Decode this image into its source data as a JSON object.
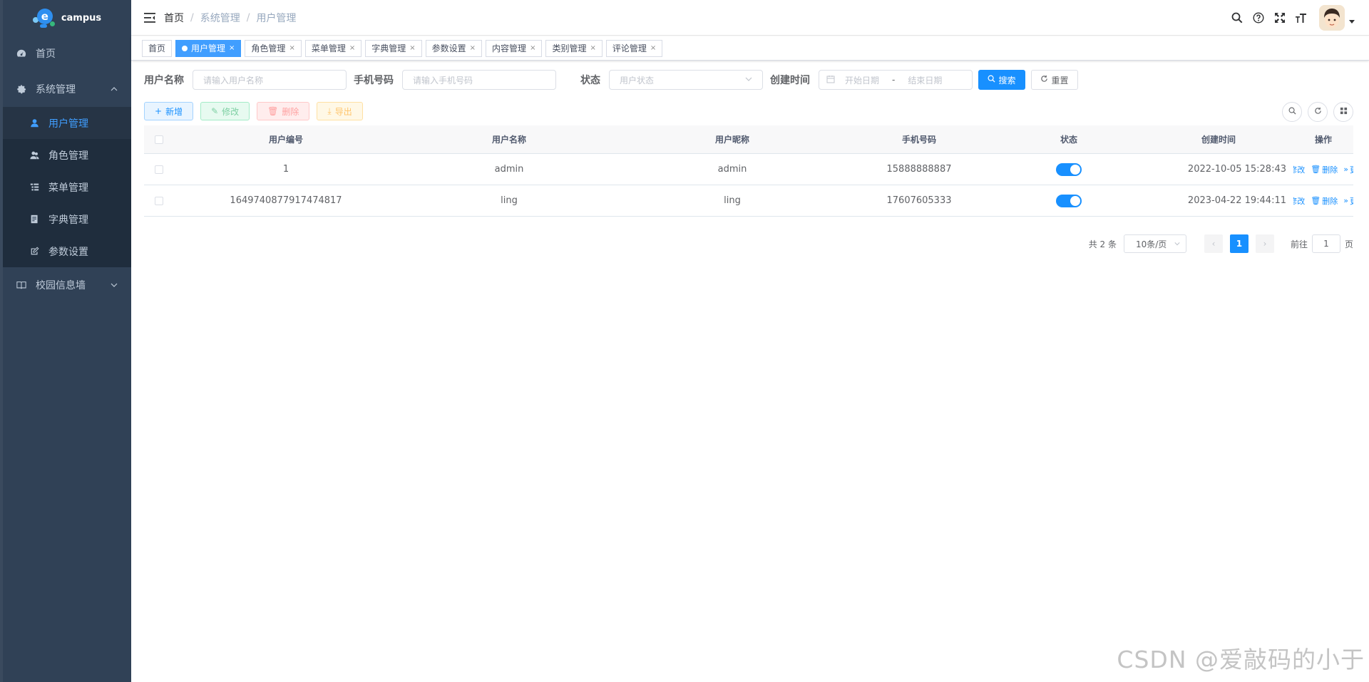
{
  "sidebar": {
    "logo_text": "campus",
    "logo_letter": "e",
    "items": [
      {
        "label": "首页",
        "icon": "dashboard-icon"
      },
      {
        "label": "系统管理",
        "icon": "gear-icon",
        "expanded": true
      },
      {
        "label": "校园信息墙",
        "icon": "book-icon",
        "expanded": false
      }
    ],
    "submenu": [
      {
        "label": "用户管理",
        "icon": "user-icon",
        "active": true
      },
      {
        "label": "角色管理",
        "icon": "peoples-icon"
      },
      {
        "label": "菜单管理",
        "icon": "tree-table-icon"
      },
      {
        "label": "字典管理",
        "icon": "dict-icon"
      },
      {
        "label": "参数设置",
        "icon": "edit-icon"
      }
    ]
  },
  "navbar": {
    "breadcrumb": [
      "首页",
      "系统管理",
      "用户管理"
    ],
    "separator": "/"
  },
  "tags": [
    {
      "label": "首页",
      "active": false,
      "closable": false
    },
    {
      "label": "用户管理",
      "active": true,
      "closable": true
    },
    {
      "label": "角色管理",
      "active": false,
      "closable": true
    },
    {
      "label": "菜单管理",
      "active": false,
      "closable": true
    },
    {
      "label": "字典管理",
      "active": false,
      "closable": true
    },
    {
      "label": "参数设置",
      "active": false,
      "closable": true
    },
    {
      "label": "内容管理",
      "active": false,
      "closable": true
    },
    {
      "label": "类别管理",
      "active": false,
      "closable": true
    },
    {
      "label": "评论管理",
      "active": false,
      "closable": true
    }
  ],
  "tag_close": "×",
  "search": {
    "username_label": "用户名称",
    "username_placeholder": "请输入用户名称",
    "phone_label": "手机号码",
    "phone_placeholder": "请输入手机号码",
    "status_label": "状态",
    "status_placeholder": "用户状态",
    "created_label": "创建时间",
    "start_placeholder": "开始日期",
    "range_sep": "-",
    "end_placeholder": "结束日期",
    "search_btn": "搜索",
    "reset_btn": "重置"
  },
  "toolbar": {
    "add": "新增",
    "edit": "修改",
    "delete": "删除",
    "export": "导出"
  },
  "table": {
    "columns": [
      "用户编号",
      "用户名称",
      "用户昵称",
      "手机号码",
      "状态",
      "创建时间",
      "操作"
    ],
    "rows": [
      {
        "id": "1",
        "username": "admin",
        "nickname": "admin",
        "phone": "15888888887",
        "status": true,
        "created": "2022-10-05 15:28:43"
      },
      {
        "id": "1649740877917474817",
        "username": "ling",
        "nickname": "ling",
        "phone": "17607605333",
        "status": true,
        "created": "2023-04-22 19:44:11"
      }
    ],
    "ops": {
      "edit": "修改",
      "delete": "删除",
      "more": "更多"
    }
  },
  "pagination": {
    "total_text": "共 2 条",
    "page_size": "10条/页",
    "current_page": "1",
    "goto_label": "前往",
    "goto_value": "1",
    "page_suffix": "页"
  },
  "watermark": "CSDN @爱敲码的小于",
  "colors": {
    "sidebar_bg": "#304156",
    "primary": "#1890ff",
    "active_menu": "#409eff"
  }
}
